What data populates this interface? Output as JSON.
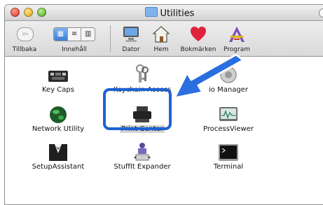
{
  "window": {
    "title": "Utilities"
  },
  "toolbar": {
    "items": [
      {
        "label": "Tillbaka",
        "icon": "back-arrow-icon"
      },
      {
        "label": "Innehåll",
        "icon": "view-mode-icon"
      },
      {
        "label": "Dator",
        "icon": "computer-icon"
      },
      {
        "label": "Hem",
        "icon": "home-icon"
      },
      {
        "label": "Bokmärken",
        "icon": "heart-icon"
      },
      {
        "label": "Program",
        "icon": "applications-icon"
      }
    ],
    "back_glyph": "⇦",
    "view_glyphs": [
      "▦",
      "≡",
      "▥"
    ]
  },
  "apps": [
    {
      "label": "Key Caps",
      "icon": "keyboard-icon"
    },
    {
      "label": "Keychain Access",
      "icon": "keys-icon"
    },
    {
      "label": "io Manager",
      "icon": "audio-midi-icon"
    },
    {
      "label": "Network Utility",
      "icon": "globe-icon"
    },
    {
      "label": "Print Center",
      "icon": "printer-icon",
      "selected": true
    },
    {
      "label": "ProcessViewer",
      "icon": "monitor-icon"
    },
    {
      "label": "SetupAssistant",
      "icon": "tuxedo-icon"
    },
    {
      "label": "StuffIt Expander",
      "icon": "stuffit-icon"
    },
    {
      "label": "Terminal",
      "icon": "terminal-icon"
    }
  ],
  "colors": {
    "highlight": "#1e62d4",
    "arrow": "#2a6ee0",
    "selection": "#d4d4d4"
  }
}
